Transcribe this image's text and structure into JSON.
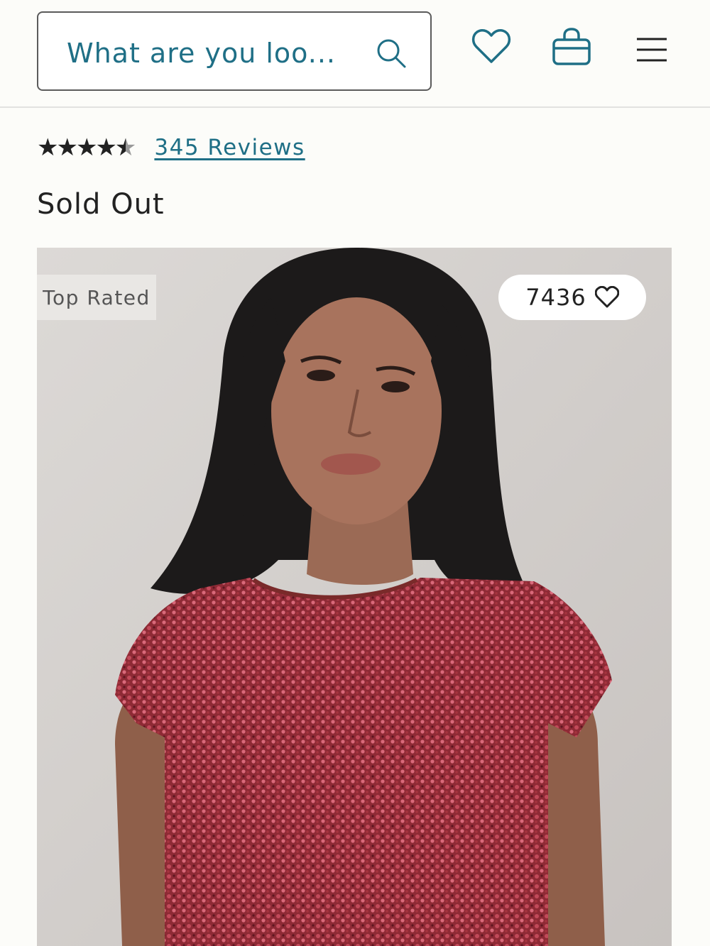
{
  "header": {
    "search_placeholder": "What are you loo...",
    "icons": [
      "search-icon",
      "heart-icon",
      "bag-icon",
      "menu-icon"
    ]
  },
  "product": {
    "rating_value": 4.5,
    "rating_max": 5,
    "reviews_label": "345 Reviews",
    "status": "Sold Out"
  },
  "image": {
    "badge": "Top Rated",
    "likes_count": "7436"
  },
  "colors": {
    "accent": "#1f6f86",
    "background": "#fcfcf9",
    "text": "#222222"
  }
}
